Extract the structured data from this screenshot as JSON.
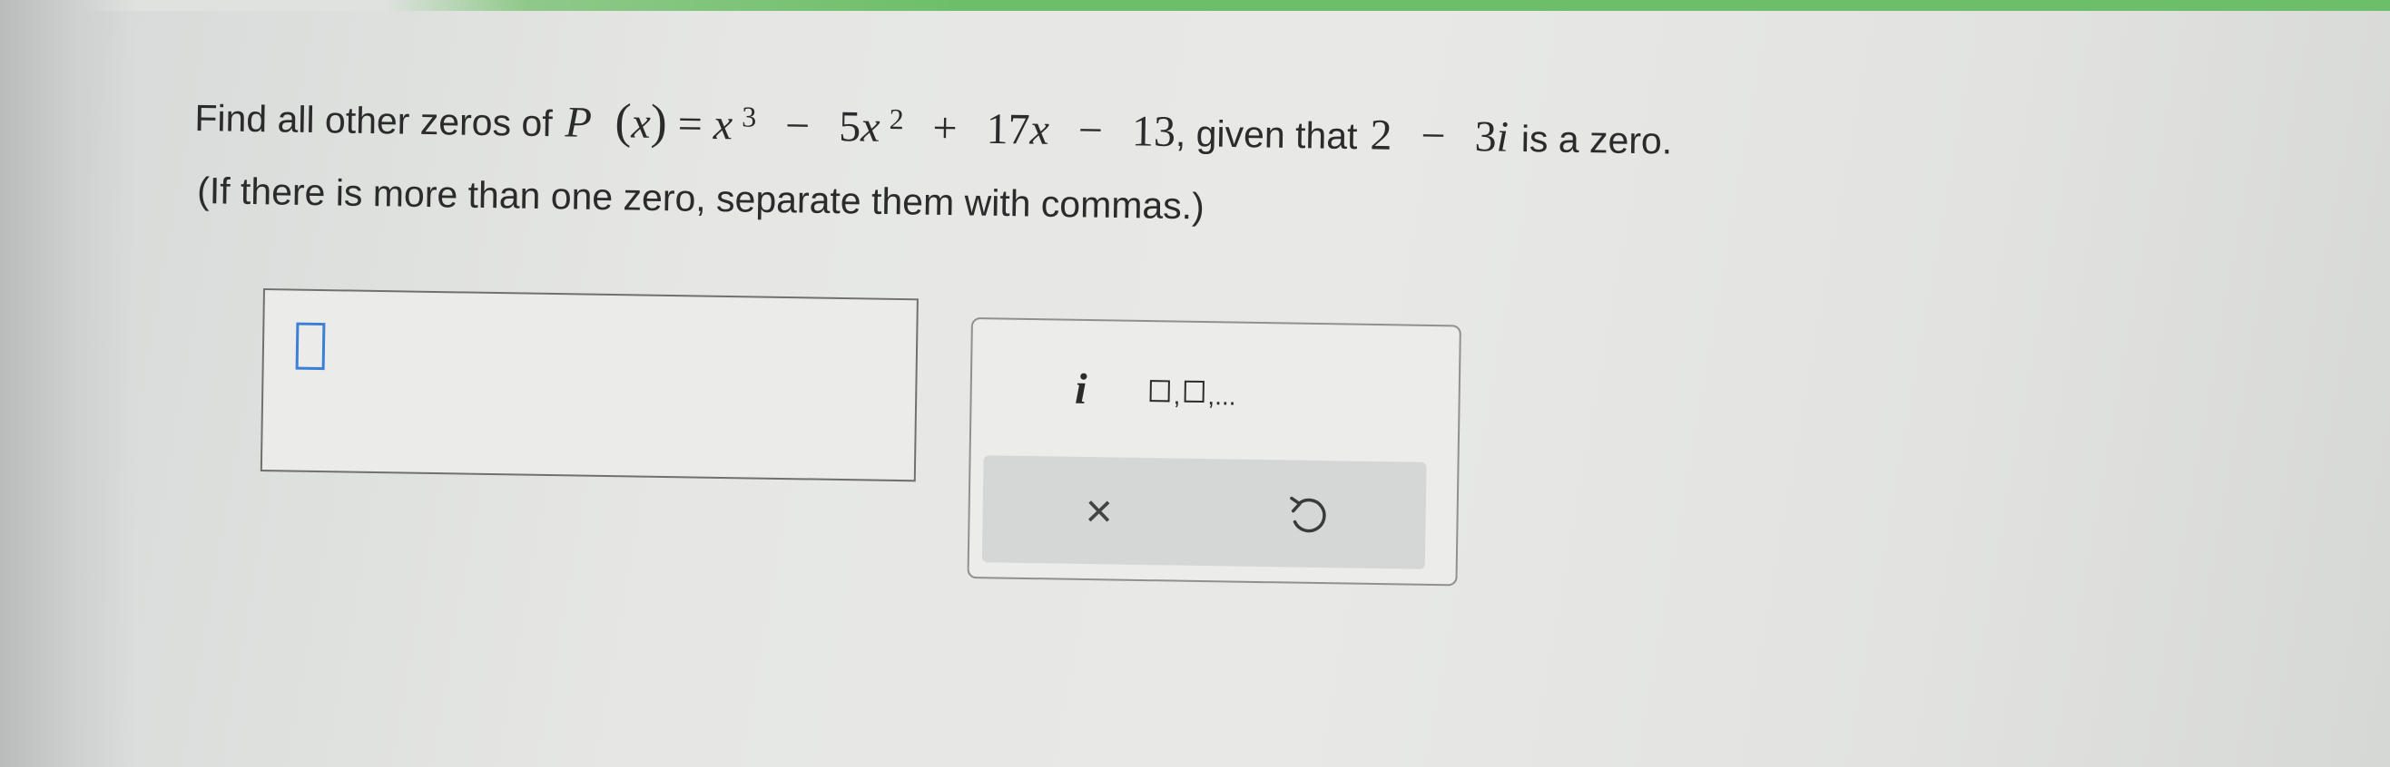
{
  "question": {
    "intro": "Find all other zeros of",
    "func_name": "P",
    "func_var": "x",
    "equals": "=",
    "term1_base": "x",
    "term1_exp": "3",
    "op1": "−",
    "term2_coef": "5",
    "term2_base": "x",
    "term2_exp": "2",
    "op2": "+",
    "term3_coef": "17",
    "term3_var": "x",
    "op3": "−",
    "term4": "13",
    "given_text": ", given that",
    "zero_real": "2",
    "zero_op": "−",
    "zero_imag_coef": "3",
    "zero_imag_unit": "i",
    "tail": "is a zero.",
    "instruction": "(If there is more than one zero, separate them with commas.)"
  },
  "keypad": {
    "imaginary_key": "i",
    "list_comma": ",",
    "list_dots": ",...",
    "clear_symbol": "×"
  }
}
